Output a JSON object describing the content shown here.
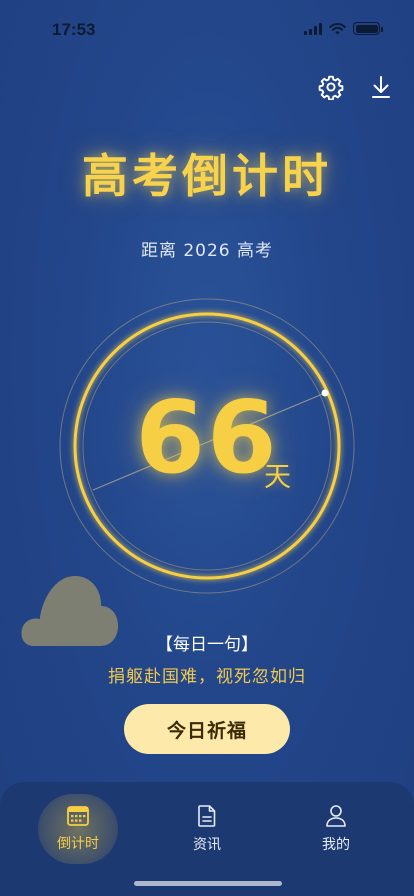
{
  "status_bar": {
    "time": "17:53",
    "icons": [
      "signal-icon",
      "wifi-icon",
      "battery-icon"
    ]
  },
  "header": {
    "actions": [
      {
        "name": "settings",
        "icon": "gear-icon"
      },
      {
        "name": "download",
        "icon": "download-icon"
      }
    ],
    "title": "高考倒计时",
    "subtitle": "距离 2026 高考"
  },
  "countdown": {
    "days": "66",
    "unit": "天"
  },
  "quote": {
    "label": "【每日一句】",
    "text": "捐躯赴国难，视死忽如归"
  },
  "primary_action": {
    "label": "今日祈福"
  },
  "tab_bar": {
    "active": "countdown",
    "items": [
      {
        "key": "countdown",
        "label": "倒计时",
        "icon": "calendar-icon"
      },
      {
        "key": "news",
        "label": "资讯",
        "icon": "document-icon"
      },
      {
        "key": "mine",
        "label": "我的",
        "icon": "person-icon"
      }
    ]
  },
  "colors": {
    "background": "#23468a",
    "accent_gold": "#f6cf45",
    "button_fill": "#fde9a9",
    "tab_bar": "#1d3972"
  }
}
